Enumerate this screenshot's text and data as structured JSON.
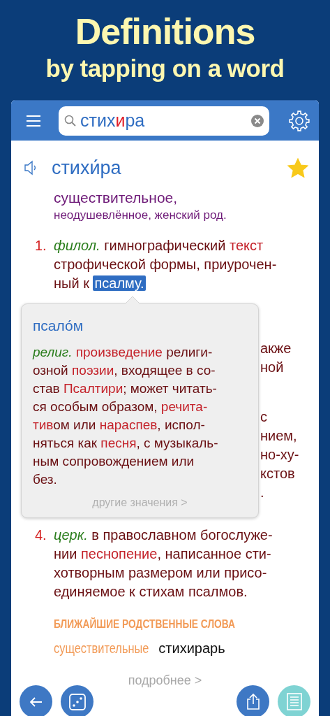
{
  "promo": {
    "title": "Definitions",
    "subtitle": "by tapping on a word"
  },
  "search": {
    "query": [
      {
        "text": "стих",
        "stressed": false
      },
      {
        "text": "и",
        "stressed": true
      },
      {
        "text": "ра",
        "stressed": false
      }
    ]
  },
  "entry": {
    "headword": "стихи́ра",
    "favorite": true,
    "grammar": [
      "существительное,",
      "неодушевлённое, женский род."
    ],
    "definitions": [
      {
        "number": "1.",
        "lines": [
          [
            {
              "kind": "label",
              "text": "филол."
            },
            {
              "kind": "text",
              "text": "гимнографический "
            },
            {
              "kind": "link",
              "text": "текст"
            }
          ],
          [
            {
              "kind": "text",
              "text": "строфической формы, приурочен-"
            }
          ],
          [
            {
              "kind": "text",
              "text": "ный к "
            },
            {
              "kind": "highlight",
              "text": "псалму."
            }
          ]
        ]
      },
      {
        "lines": [
          [
            {
              "kind": "text",
              "text": "акже"
            }
          ],
          [
            {
              "kind": "text",
              "text": "ной"
            }
          ]
        ]
      },
      {
        "lines": [
          [
            {
              "kind": "text",
              "text": "с"
            }
          ],
          [
            {
              "kind": "text",
              "text": "нием,"
            }
          ],
          [
            {
              "kind": "text",
              "text": "но-ху-"
            }
          ],
          [
            {
              "kind": "text",
              "text": "кстов"
            }
          ],
          [
            {
              "kind": "text",
              "text": "."
            }
          ]
        ]
      },
      {
        "number": "4.",
        "lines": [
          [
            {
              "kind": "label",
              "text": "церк."
            },
            {
              "kind": "text",
              "text": "в православном богослуже-"
            }
          ],
          [
            {
              "kind": "text",
              "text": "нии "
            },
            {
              "kind": "link",
              "text": "песнопение"
            },
            {
              "kind": "text",
              "text": ", написанное сти-"
            }
          ],
          [
            {
              "kind": "text",
              "text": "хотворным размером или присо-"
            }
          ],
          [
            {
              "kind": "text",
              "text": "единяемое к стихам псалмов."
            }
          ]
        ]
      }
    ],
    "related": {
      "heading": "БЛИЖАЙШИЕ РОДСТВЕННЫЕ СЛОВА",
      "groups": [
        {
          "category": "существительные",
          "words": [
            "стихирарь"
          ]
        }
      ]
    },
    "more": "подробнее >"
  },
  "popup": {
    "headword": "псало́м",
    "lines": [
      [
        {
          "kind": "label",
          "text": "религ."
        },
        {
          "kind": "link",
          "text": "произведение"
        },
        {
          "kind": "text",
          "text": " религи-"
        }
      ],
      [
        {
          "kind": "text",
          "text": "озной "
        },
        {
          "kind": "link",
          "text": "поэзии"
        },
        {
          "kind": "text",
          "text": ", входящее в со-"
        }
      ],
      [
        {
          "kind": "text",
          "text": "став "
        },
        {
          "kind": "link",
          "text": "Псалтири"
        },
        {
          "kind": "text",
          "text": "; может читать-"
        }
      ],
      [
        {
          "kind": "text",
          "text": "ся особым образом, "
        },
        {
          "kind": "link",
          "text": "речита-"
        }
      ],
      [
        {
          "kind": "link",
          "text": "тив"
        },
        {
          "kind": "text",
          "text": "ом или "
        },
        {
          "kind": "link",
          "text": "нараспев"
        },
        {
          "kind": "text",
          "text": ", испол-"
        }
      ],
      [
        {
          "kind": "text",
          "text": "няться как "
        },
        {
          "kind": "link",
          "text": "песня"
        },
        {
          "kind": "text",
          "text": ", с музыкаль-"
        }
      ],
      [
        {
          "kind": "text",
          "text": "ным сопровождением или"
        }
      ],
      [
        {
          "kind": "text",
          "text": "без."
        }
      ]
    ],
    "more": "другие значения >"
  },
  "toolbar": [
    {
      "kind": "back",
      "active": false
    },
    {
      "kind": "dice",
      "active": false
    },
    {
      "kind": "share",
      "active": false
    },
    {
      "kind": "list",
      "active": true
    }
  ]
}
